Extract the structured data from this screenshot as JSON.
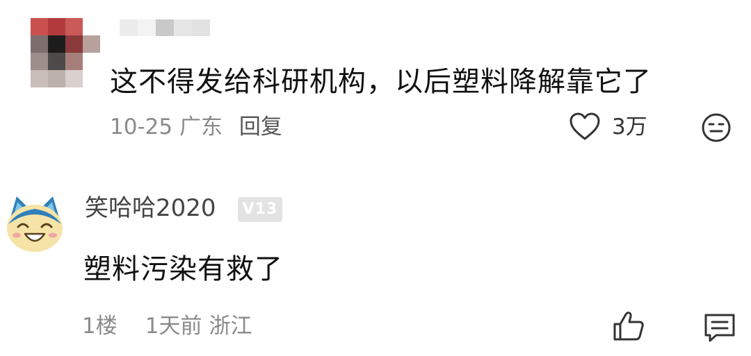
{
  "comments": [
    {
      "text": "这不得发给科研机构，以后塑料降解靠它了",
      "date": "10-25",
      "location": "广东",
      "reply_label": "回复",
      "like_count": "3万",
      "icons": [
        "heart-icon",
        "dislike-face-icon"
      ]
    },
    {
      "username": "笑哈哈2020",
      "level_badge": "V13",
      "text": "塑料污染有救了",
      "floor": "1楼",
      "time": "1天前",
      "location": "浙江",
      "icons": [
        "thumbs-up-icon",
        "comment-bubble-icon"
      ]
    }
  ]
}
